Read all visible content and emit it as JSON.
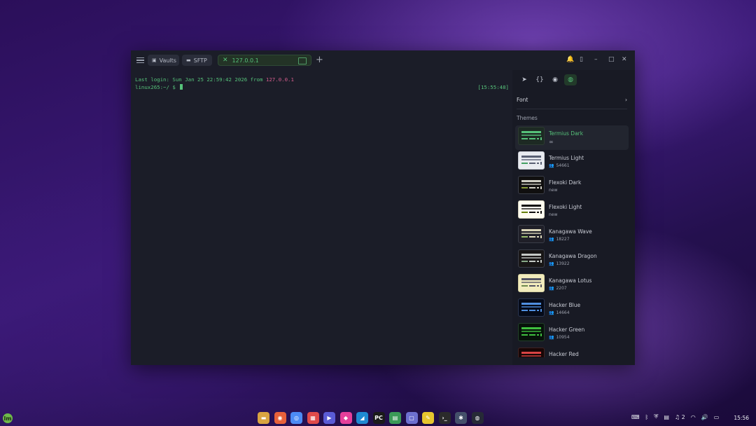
{
  "tabs": {
    "vaults": "Vaults",
    "sftp": "SFTP",
    "active": "127.0.0.1",
    "add": "+"
  },
  "window_controls": {
    "bell": "🔔",
    "layout": "▯",
    "minimize": "–",
    "maximize": "□",
    "close": "✕"
  },
  "terminal": {
    "login_prefix": "Last login: Sun Jan 25 22:59:42 2026 from ",
    "login_host": "127.0.0.1",
    "prompt": "linux265:~/ $ ",
    "timestamp": "[15:55:48]"
  },
  "panel": {
    "tabs": [
      "➤",
      "{}",
      "◉",
      "◍"
    ],
    "font_label": "Font",
    "font_chevron": "›",
    "themes_label": "Themes",
    "themes": [
      {
        "name": "Termius Dark",
        "meta": "∞",
        "infinite": true,
        "bg": "#1d2a23",
        "c1": "#56c27a",
        "c2": "#56c27a",
        "c3": "#56c27a",
        "border": "#2d3a32"
      },
      {
        "name": "Termius Light",
        "meta": "54661",
        "bg": "#e9ebf0",
        "c1": "#5a6074",
        "c2": "#5a6074",
        "c3": "#44a063",
        "border": "#c9ccd4"
      },
      {
        "name": "Flexoki Dark",
        "meta": "new",
        "bg": "#100f0f",
        "c1": "#cecdc3",
        "c2": "#cecdc3",
        "c3": "#879a39",
        "border": "#3a3d48"
      },
      {
        "name": "Flexoki Light",
        "meta": "new",
        "bg": "#fffcf0",
        "c1": "#100f0f",
        "c2": "#100f0f",
        "c3": "#66800b",
        "border": "#d8d4c0"
      },
      {
        "name": "Kanagawa Wave",
        "meta": "18227",
        "bg": "#1f1f28",
        "c1": "#dcd7ba",
        "c2": "#dcd7ba",
        "c3": "#98bb6c",
        "border": "#3a3d48"
      },
      {
        "name": "Kanagawa Dragon",
        "meta": "13922",
        "bg": "#181616",
        "c1": "#c5c9c5",
        "c2": "#c5c9c5",
        "c3": "#87a987",
        "border": "#3a3d48"
      },
      {
        "name": "Kanagawa Lotus",
        "meta": "2207",
        "bg": "#f2ecbc",
        "c1": "#545464",
        "c2": "#545464",
        "c3": "#6f894e",
        "border": "#d5cfa0"
      },
      {
        "name": "Hacker Blue",
        "meta": "14664",
        "bg": "#050a18",
        "c1": "#4f8fe0",
        "c2": "#4f8fe0",
        "c3": "#4f8fe0",
        "border": "#2a3550"
      },
      {
        "name": "Hacker Green",
        "meta": "10954",
        "bg": "#07120a",
        "c1": "#3fbf3f",
        "c2": "#3fbf3f",
        "c3": "#3fbf3f",
        "border": "#23402a"
      },
      {
        "name": "Hacker Red",
        "meta": "",
        "bg": "#180606",
        "c1": "#d94444",
        "c2": "#d94444",
        "c3": "#d94444",
        "border": "#402323"
      }
    ]
  },
  "taskbar": {
    "start": "lm",
    "apps": [
      {
        "name": "files",
        "glyph": "▬",
        "color": "#d9a441"
      },
      {
        "name": "firefox",
        "glyph": "◉",
        "color": "#e8613a"
      },
      {
        "name": "chrome",
        "glyph": "◎",
        "color": "#4c8bf5"
      },
      {
        "name": "calendar",
        "glyph": "▦",
        "color": "#e04a4a"
      },
      {
        "name": "media",
        "glyph": "▶",
        "color": "#5a5bd6"
      },
      {
        "name": "browser",
        "glyph": "◆",
        "color": "#e63f9b"
      },
      {
        "name": "vscode",
        "glyph": "◢",
        "color": "#1f8ad2"
      },
      {
        "name": "pycharm",
        "glyph": "PC",
        "color": "#1a1a1a"
      },
      {
        "name": "monitor",
        "glyph": "▤",
        "color": "#3b9a58"
      },
      {
        "name": "screen",
        "glyph": "▢",
        "color": "#6d6fd0"
      },
      {
        "name": "notes",
        "glyph": "✎",
        "color": "#e6c52e"
      },
      {
        "name": "terminal",
        "glyph": "›_",
        "color": "#2b2b2b"
      },
      {
        "name": "network",
        "glyph": "✱",
        "color": "#44506a"
      },
      {
        "name": "termius",
        "glyph": "◍",
        "color": "#262a36"
      }
    ],
    "tray": [
      "⌨",
      "ᛒ",
      "⛨",
      "▤",
      "♫ 2",
      "◠",
      "🔊",
      "▭"
    ],
    "clock": "15:56"
  },
  "colors": {
    "accent": "#56c27a",
    "host": "#d65e8e",
    "window_bg": "#1b1d28",
    "panel_bg": "#181a24"
  }
}
